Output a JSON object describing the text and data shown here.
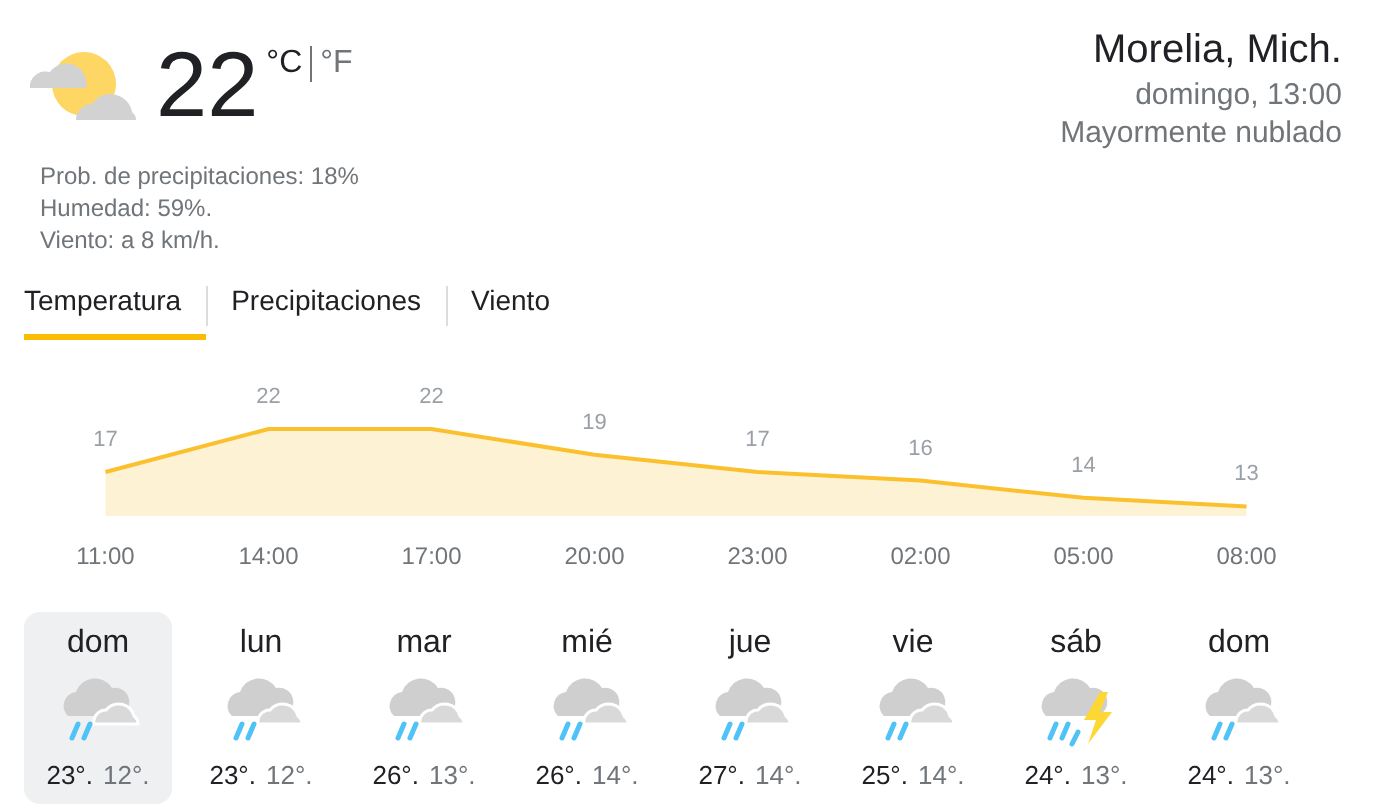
{
  "current": {
    "temperature": "22",
    "units": [
      {
        "label": "°C",
        "selected": true
      },
      {
        "label": "°F",
        "selected": false
      }
    ],
    "details": [
      "Prob. de precipitaciones: 18%",
      "Humedad: 59%.",
      "Viento: a 8 km/h."
    ]
  },
  "location": {
    "place": "Morelia, Mich.",
    "time": "domingo, 13:00",
    "condition": "Mayormente nublado"
  },
  "tabs": [
    {
      "label": "Temperatura",
      "selected": true
    },
    {
      "label": "Precipitaciones",
      "selected": false
    },
    {
      "label": "Viento",
      "selected": false
    }
  ],
  "chart": {
    "chart_data": {
      "type": "area",
      "categories": [
        "11:00",
        "14:00",
        "17:00",
        "20:00",
        "23:00",
        "02:00",
        "05:00",
        "08:00"
      ],
      "series": [
        {
          "color": "#fbc02d",
          "values": [
            17,
            22,
            22,
            19,
            17,
            16,
            14,
            13
          ]
        }
      ],
      "data_labels": true
    }
  },
  "days": [
    {
      "day": "dom",
      "kind": "rain",
      "high": "23°.",
      "low": "12°.",
      "selected": true
    },
    {
      "day": "lun",
      "kind": "rain",
      "high": "23°.",
      "low": "12°.",
      "selected": false
    },
    {
      "day": "mar",
      "kind": "rain",
      "high": "26°.",
      "low": "13°.",
      "selected": false
    },
    {
      "day": "mié",
      "kind": "rain",
      "high": "26°.",
      "low": "14°.",
      "selected": false
    },
    {
      "day": "jue",
      "kind": "rain",
      "high": "27°.",
      "low": "14°.",
      "selected": false
    },
    {
      "day": "vie",
      "kind": "rain",
      "high": "25°.",
      "low": "14°.",
      "selected": false
    },
    {
      "day": "sáb",
      "kind": "storm",
      "high": "24°.",
      "low": "13°.",
      "selected": false
    },
    {
      "day": "dom",
      "kind": "rain",
      "high": "24°.",
      "low": "13°.",
      "selected": false
    }
  ]
}
